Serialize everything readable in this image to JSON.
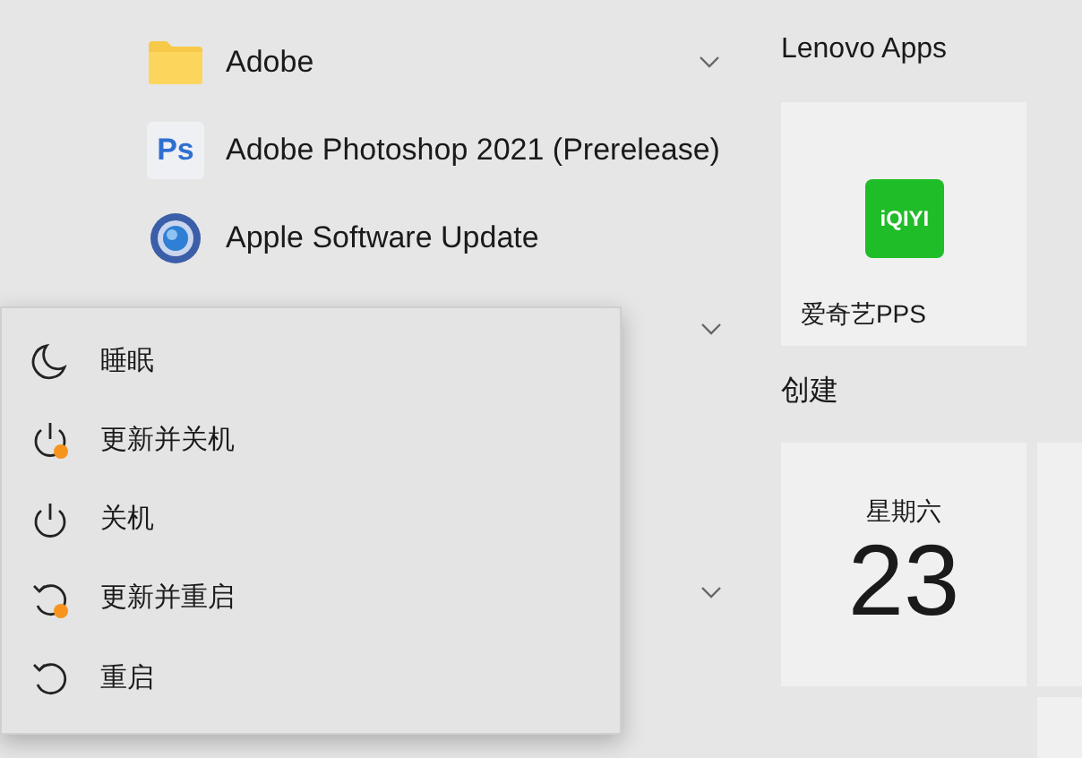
{
  "app_list": [
    {
      "label": "Adobe",
      "kind": "folder",
      "expandable": true
    },
    {
      "label": "Adobe Photoshop 2021 (Prerelease)",
      "kind": "ps",
      "icon_text": "Ps",
      "expandable": false
    },
    {
      "label": "Apple Software Update",
      "kind": "apple_update",
      "expandable": false
    }
  ],
  "power_menu": [
    {
      "kind": "sleep",
      "label": "睡眠",
      "update_pending": false
    },
    {
      "kind": "power",
      "label": "更新并关机",
      "update_pending": true
    },
    {
      "kind": "power",
      "label": "关机",
      "update_pending": false
    },
    {
      "kind": "restart",
      "label": "更新并重启",
      "update_pending": true
    },
    {
      "kind": "restart",
      "label": "重启",
      "update_pending": false
    }
  ],
  "groups": [
    {
      "title": "Lenovo Apps",
      "tiles": [
        {
          "kind": "app",
          "label": "爱奇艺PPS",
          "logo_text": "iQIYI"
        }
      ]
    },
    {
      "title": "创建",
      "tiles": [
        {
          "kind": "calendar",
          "weekday": "星期六",
          "day": "23"
        }
      ]
    }
  ]
}
